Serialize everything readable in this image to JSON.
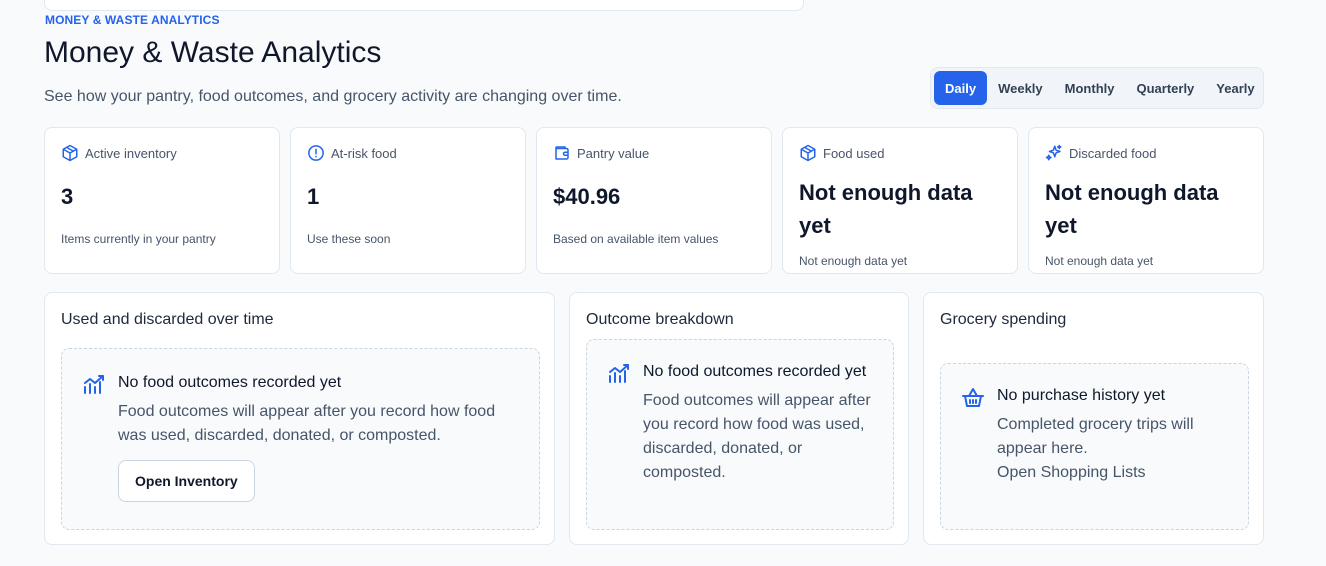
{
  "header": {
    "eyebrow": "MONEY & WASTE ANALYTICS",
    "title": "Money & Waste Analytics",
    "subtitle": "See how your pantry, food outcomes, and grocery activity are changing over time."
  },
  "periods": {
    "selected": "Daily",
    "options": [
      "Daily",
      "Weekly",
      "Monthly",
      "Quarterly",
      "Yearly"
    ]
  },
  "stats": [
    {
      "icon": "package-icon",
      "label": "Active inventory",
      "value": "3",
      "caption": "Items currently in your pantry"
    },
    {
      "icon": "alert-circle-icon",
      "label": "At-risk food",
      "value": "1",
      "caption": "Use these soon"
    },
    {
      "icon": "wallet-icon",
      "label": "Pantry value",
      "value": "$40.96",
      "caption": "Based on available item values"
    },
    {
      "icon": "package-icon",
      "label": "Food used",
      "value": "Not enough data yet",
      "caption": "Not enough data yet"
    },
    {
      "icon": "sparkles-icon",
      "label": "Discarded food",
      "value": "Not enough data yet",
      "caption": "Not enough data yet"
    }
  ],
  "panels": {
    "trend": {
      "title": "Used and discarded over time",
      "empty_title": "No food outcomes recorded yet",
      "empty_desc": "Food outcomes will appear after you record how food was used, discarded, donated, or composted.",
      "button": "Open Inventory"
    },
    "breakdown": {
      "title": "Outcome breakdown",
      "empty_title": "No food outcomes recorded yet",
      "empty_desc": "Food outcomes will appear after you record how food was used, discarded, donated, or composted."
    },
    "spending": {
      "title": "Grocery spending",
      "empty_title": "No purchase history yet",
      "empty_desc": "Completed grocery trips will appear here.",
      "link": "Open Shopping Lists"
    }
  },
  "colors": {
    "accent": "#2563eb",
    "card_border": "#e2e8f0",
    "text_primary": "#0f172a",
    "text_muted": "#475569"
  }
}
